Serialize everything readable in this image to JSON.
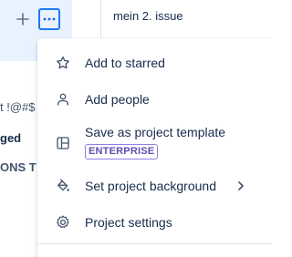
{
  "sidebar": {
    "add_icon": "plus-icon",
    "more_icon": "more-horizontal-icon",
    "text_lines": [
      "t !@#$",
      "ged",
      "ONS T"
    ]
  },
  "issue": {
    "title": "mein 2. issue"
  },
  "menu": {
    "items": [
      {
        "icon": "star-icon",
        "label": "Add to starred"
      },
      {
        "icon": "person-icon",
        "label": "Add people"
      },
      {
        "icon": "template-icon",
        "label": "Save as project template",
        "badge": "ENTERPRISE"
      },
      {
        "icon": "paint-bucket-icon",
        "label": "Set project background",
        "chevron": "chevron-right-icon"
      },
      {
        "icon": "gear-icon",
        "label": "Project settings"
      }
    ]
  },
  "colors": {
    "accent": "#1d7afc",
    "selected_bg": "#e9f2ff",
    "text": "#172b4d",
    "badge_purple": "#5e4db2"
  }
}
